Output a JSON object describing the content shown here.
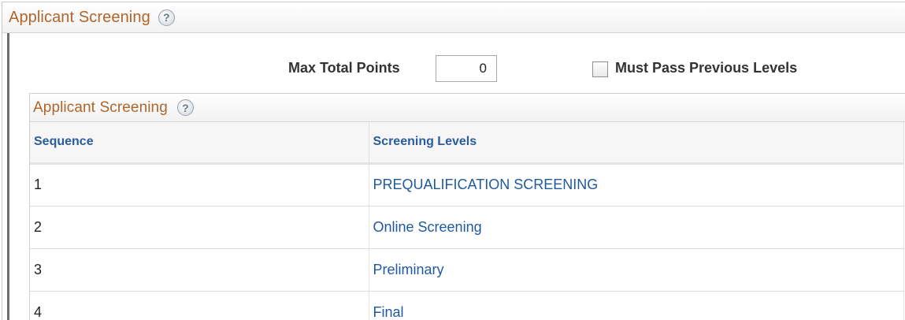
{
  "outer_section": {
    "title": "Applicant Screening"
  },
  "controls": {
    "max_total_points_label": "Max Total Points",
    "max_total_points_value": "0",
    "must_pass_label": "Must Pass Previous Levels",
    "must_pass_checked": false
  },
  "grid": {
    "title": "Applicant Screening",
    "columns": [
      "Sequence",
      "Screening Levels"
    ],
    "rows": [
      {
        "sequence": "1",
        "level": "PREQUALIFICATION SCREENING"
      },
      {
        "sequence": "2",
        "level": "Online Screening"
      },
      {
        "sequence": "3",
        "level": "Preliminary"
      },
      {
        "sequence": "4",
        "level": "Final"
      }
    ]
  },
  "icons": {
    "help": "help-icon"
  },
  "colors": {
    "section_title": "#b0652a",
    "column_header": "#2a5d9a",
    "link": "#1f5a9e"
  }
}
